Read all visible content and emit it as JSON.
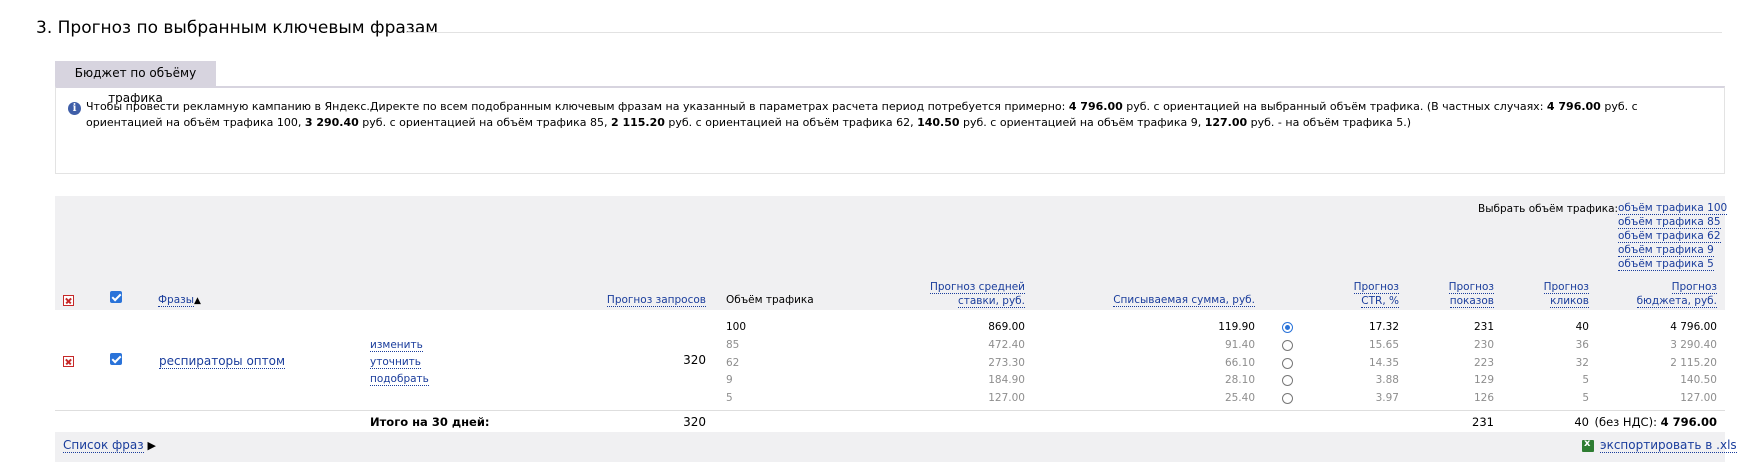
{
  "section": {
    "title": "3. Прогноз по выбранным ключевым фразам"
  },
  "tab": {
    "label": "Бюджет по объёму трафика"
  },
  "info": {
    "p1": "Чтобы провести рекламную кампанию в Яндекс.Директе по всем подобранным ключевым фразам на указанный в параметрах расчета период потребуется примерно: ",
    "v1": "4 796.00",
    "p2": " руб. с ориентацией на выбранный объём трафика. (В частных случаях: ",
    "v2": "4 796.00",
    "p3": " руб. с ориентацией на объём трафика 100, ",
    "v3": "3 290.40",
    "p4": " руб. с ориентацией на объём трафика 85, ",
    "v4": "2 115.20",
    "p5": " руб. с ориентацией на объём трафика 62, ",
    "v5": "140.50",
    "p6": " руб. с ориентацией на объём трафика 9, ",
    "v6": "127.00",
    "p7": " руб. - на объём трафика 5.)"
  },
  "traffic_select": {
    "label": "Выбрать объём трафика:",
    "options": [
      "объём трафика 100",
      "объём трафика 85",
      "объём трафика 62",
      "объём трафика 9",
      "объём трафика 5"
    ]
  },
  "columns": {
    "phrases": "Фразы",
    "sort_arrow": "▲",
    "requests": "Прогноз запросов",
    "traffic": "Объём трафика",
    "bid_l1": "Прогноз средней",
    "bid_l2": "ставки, руб.",
    "charge": "Списываемая сумма, руб.",
    "ctr_l1": "Прогноз",
    "ctr_l2": "CTR, %",
    "shows_l1": "Прогноз",
    "shows_l2": "показов",
    "clicks_l1": "Прогноз",
    "clicks_l2": "кликов",
    "budget_l1": "Прогноз",
    "budget_l2": "бюджета, руб."
  },
  "row": {
    "phrase": "респираторы оптом",
    "actions": [
      "изменить",
      "уточнить",
      "подобрать"
    ],
    "requests": "320",
    "selected_index": 0,
    "levels": [
      {
        "traffic": "100",
        "bid": "869.00",
        "charge": "119.90",
        "ctr": "17.32",
        "shows": "231",
        "clicks": "40",
        "budget": "4 796.00"
      },
      {
        "traffic": "85",
        "bid": "472.40",
        "charge": "91.40",
        "ctr": "15.65",
        "shows": "230",
        "clicks": "36",
        "budget": "3 290.40"
      },
      {
        "traffic": "62",
        "bid": "273.30",
        "charge": "66.10",
        "ctr": "14.35",
        "shows": "223",
        "clicks": "32",
        "budget": "2 115.20"
      },
      {
        "traffic": "9",
        "bid": "184.90",
        "charge": "28.10",
        "ctr": "3.88",
        "shows": "129",
        "clicks": "5",
        "budget": "140.50"
      },
      {
        "traffic": "5",
        "bid": "127.00",
        "charge": "25.40",
        "ctr": "3.97",
        "shows": "126",
        "clicks": "5",
        "budget": "127.00"
      }
    ]
  },
  "totals": {
    "label": "Итого на 30 дней:",
    "requests": "320",
    "shows": "231",
    "clicks": "40",
    "budget_prefix": "(без НДС): ",
    "budget": "4 796.00"
  },
  "footer": {
    "phrase_list": "Список фраз",
    "phrase_list_arrow": "▶",
    "export": "экспортировать в .xls"
  },
  "colors": {
    "link": "#1a3d9c",
    "header_bg": "#f0f0f2",
    "tab_bg": "#d7d4df",
    "checkbox": "#2a73d9",
    "delete": "#c62828"
  }
}
